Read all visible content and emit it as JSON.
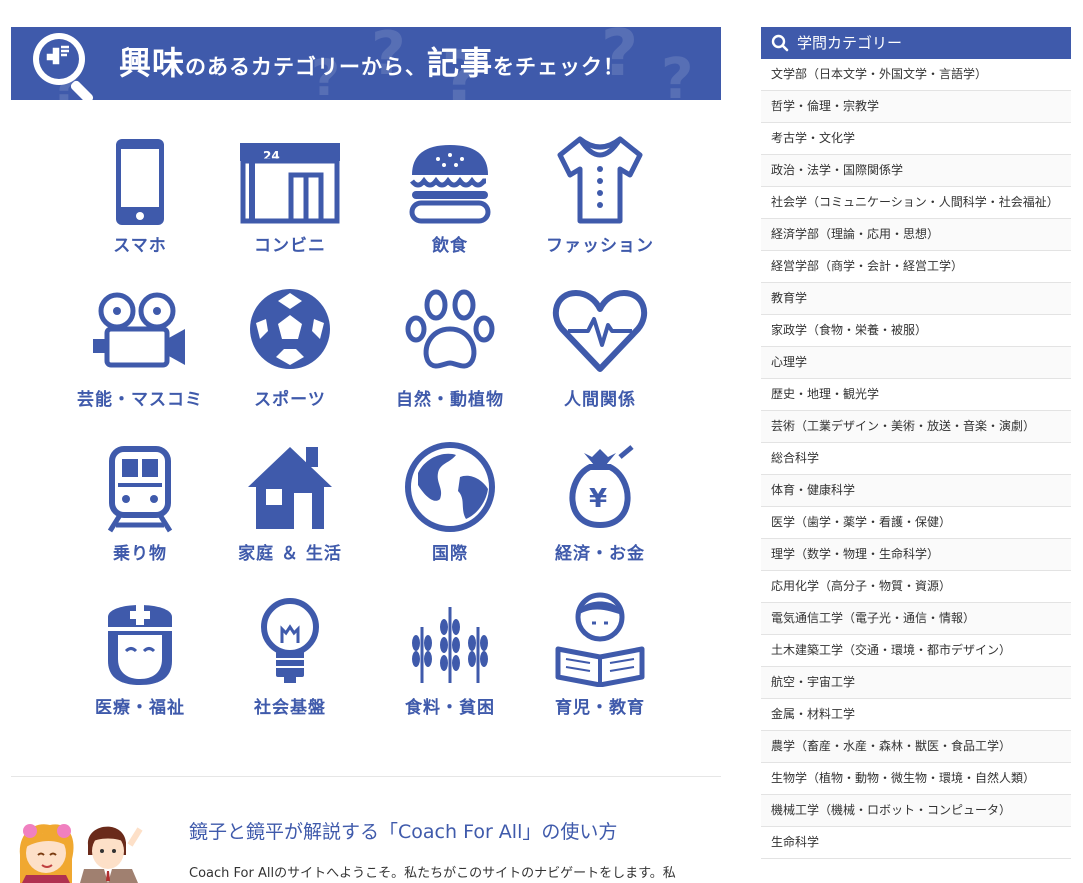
{
  "banner": {
    "part1": "興味",
    "part2": "のあるカテゴリーから、",
    "part3": "記事",
    "part4": "をチェック！"
  },
  "categories": [
    {
      "label": "スマホ",
      "icon": "smartphone-icon"
    },
    {
      "label": "コンビニ",
      "icon": "convenience-store-icon"
    },
    {
      "label": "飲食",
      "icon": "hamburger-icon"
    },
    {
      "label": "ファッション",
      "icon": "shirt-icon"
    },
    {
      "label": "芸能・マスコミ",
      "icon": "video-camera-icon"
    },
    {
      "label": "スポーツ",
      "icon": "soccer-ball-icon"
    },
    {
      "label": "自然・動植物",
      "icon": "paw-icon"
    },
    {
      "label": "人間関係",
      "icon": "heart-pulse-icon"
    },
    {
      "label": "乗り物",
      "icon": "train-icon"
    },
    {
      "label": "家庭 ＆ 生活",
      "icon": "house-icon"
    },
    {
      "label": "国際",
      "icon": "globe-icon"
    },
    {
      "label": "経済・お金",
      "icon": "money-bag-yen-icon"
    },
    {
      "label": "医療・福祉",
      "icon": "nurse-icon"
    },
    {
      "label": "社会基盤",
      "icon": "light-bulb-icon"
    },
    {
      "label": "食料・貧困",
      "icon": "wheat-icon"
    },
    {
      "label": "育児・教育",
      "icon": "child-reading-icon"
    }
  ],
  "intro": {
    "title": "鏡子と鏡平が解説する「Coach For All」の使い方",
    "text": "Coach For Allのサイトへようこそ。私たちがこのサイトのナビゲートをします。私"
  },
  "sidebar": {
    "heading": "学問カテゴリー",
    "items": [
      "文学部（日本文学・外国文学・言語学）",
      "哲学・倫理・宗教学",
      "考古学・文化学",
      "政治・法学・国際関係学",
      "社会学（コミュニケーション・人間科学・社会福祉）",
      "経済学部（理論・応用・思想）",
      "経営学部（商学・会計・経営工学）",
      "教育学",
      "家政学（食物・栄養・被服）",
      "心理学",
      "歴史・地理・観光学",
      "芸術（工業デザイン・美術・放送・音楽・演劇）",
      "総合科学",
      "体育・健康科学",
      "医学（歯学・薬学・看護・保健）",
      "理学（数学・物理・生命科学）",
      "応用化学（高分子・物質・資源）",
      "電気通信工学（電子光・通信・情報）",
      "土木建築工学（交通・環境・都市デザイン）",
      "航空・宇宙工学",
      "金属・材料工学",
      "農学（畜産・水産・森林・獣医・食品工学）",
      "生物学（植物・動物・微生物・環境・自然人類）",
      "機械工学（機械・ロボット・コンピュータ）",
      "生命科学"
    ]
  },
  "colors": {
    "accent": "#3f5aab"
  }
}
